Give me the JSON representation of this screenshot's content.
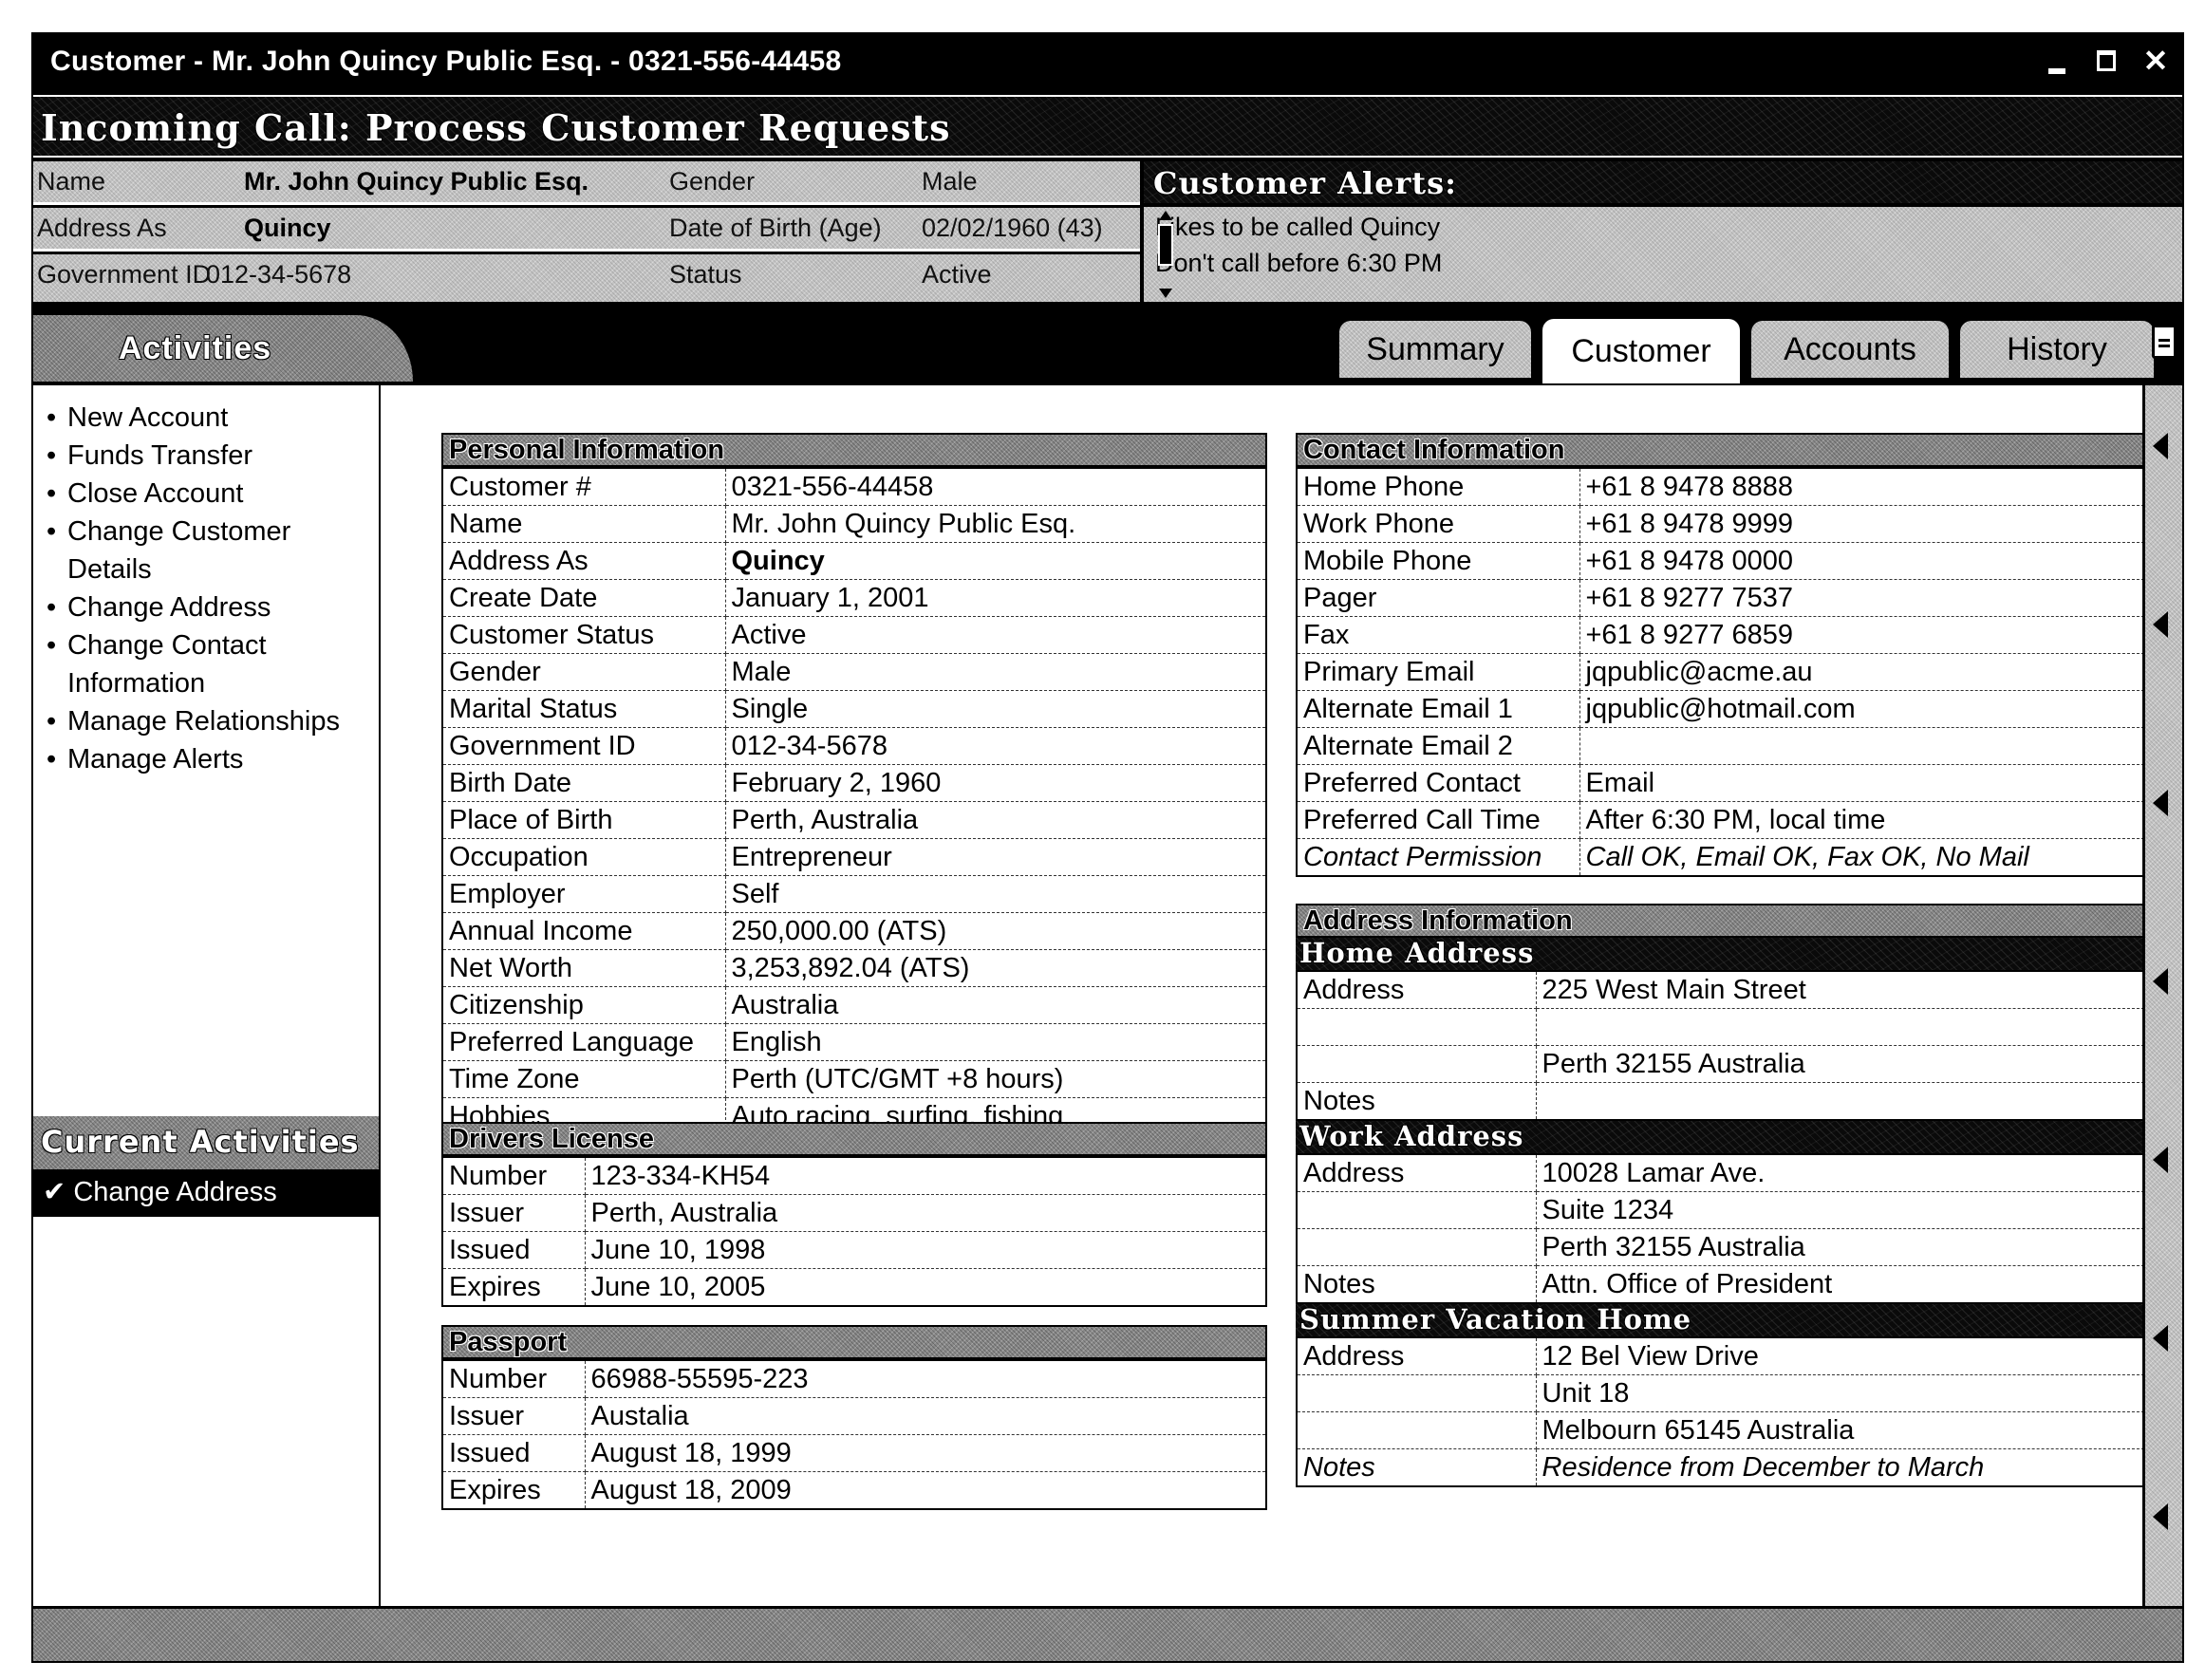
{
  "window": {
    "title": "Customer -   Mr. John Quincy Public Esq. - 0321-556-44458",
    "controls": {
      "minimize": "minimize-icon",
      "maximize": "maximize-icon",
      "close": "close-icon"
    }
  },
  "banner": {
    "title": "Incoming Call: Process Customer Requests"
  },
  "summary": {
    "rows": [
      {
        "label1": "Name",
        "value1": "Mr. John Quincy Public Esq.",
        "label2": "Gender",
        "value2": "Male"
      },
      {
        "label1": "Address As",
        "value1": "Quincy",
        "label2": "Date of Birth (Age)",
        "value2": "02/02/1960 (43)"
      },
      {
        "label1": "Government ID",
        "value1": "012-34-5678",
        "label2": "Status",
        "value2": "Active"
      }
    ]
  },
  "alerts": {
    "title": "Customer Alerts:",
    "items": [
      "Likes to be called Quincy",
      "Don't call before 6:30 PM"
    ]
  },
  "sidebar": {
    "title": "Activities",
    "items": [
      {
        "label": "New Account"
      },
      {
        "label": "Funds Transfer"
      },
      {
        "label": "Close Account"
      },
      {
        "label": "Change Customer Details"
      },
      {
        "label": "Change Address"
      },
      {
        "label": "Change Contact Information"
      },
      {
        "label": "Manage Relationships"
      },
      {
        "label": "Manage Alerts"
      }
    ],
    "current_title": "Current Activities >>",
    "current_items": [
      {
        "label": "✔ Change Address"
      }
    ]
  },
  "tabs": [
    {
      "label": "Summary",
      "active": false
    },
    {
      "label": "Customer",
      "active": true
    },
    {
      "label": "Accounts",
      "active": false
    },
    {
      "label": "History",
      "active": false
    }
  ],
  "personal": {
    "title": "Personal Information",
    "rows": [
      {
        "label": "Customer #",
        "value": "0321-556-44458"
      },
      {
        "label": "Name",
        "value": "Mr. John Quincy Public Esq."
      },
      {
        "label": "Address As",
        "value": "Quincy"
      },
      {
        "label": "Create Date",
        "value": "January 1, 2001"
      },
      {
        "label": "Customer Status",
        "value": "Active"
      },
      {
        "label": "Gender",
        "value": "Male"
      },
      {
        "label": "Marital Status",
        "value": "Single"
      },
      {
        "label": "Government ID",
        "value": "012-34-5678"
      },
      {
        "label": "Birth Date",
        "value": "February 2, 1960"
      },
      {
        "label": "Place of Birth",
        "value": "Perth, Australia"
      },
      {
        "label": "Occupation",
        "value": "Entrepreneur"
      },
      {
        "label": "Employer",
        "value": "Self"
      },
      {
        "label": "Annual Income",
        "value": "250,000.00 (ATS)"
      },
      {
        "label": "Net Worth",
        "value": "3,253,892.04 (ATS)"
      },
      {
        "label": "Citizenship",
        "value": "Australia"
      },
      {
        "label": "Preferred Language",
        "value": "English"
      },
      {
        "label": "Time Zone",
        "value": "Perth (UTC/GMT +8 hours)"
      },
      {
        "label": "Hobbies",
        "value": "Auto racing, surfing, fishing"
      }
    ]
  },
  "license": {
    "title": "Drivers License",
    "rows": [
      {
        "label": "Number",
        "value": "123-334-KH54"
      },
      {
        "label": "Issuer",
        "value": "Perth, Australia"
      },
      {
        "label": "Issued",
        "value": "June 10, 1998"
      },
      {
        "label": "Expires",
        "value": "June 10, 2005"
      }
    ]
  },
  "passport": {
    "title": "Passport",
    "rows": [
      {
        "label": "Number",
        "value": "66988-55595-223"
      },
      {
        "label": "Issuer",
        "value": "Austalia"
      },
      {
        "label": "Issued",
        "value": "August 18, 1999"
      },
      {
        "label": "Expires",
        "value": "August 18, 2009"
      }
    ]
  },
  "contact": {
    "title": "Contact Information",
    "rows": [
      {
        "label": "Home Phone",
        "value": "+61 8 9478 8888"
      },
      {
        "label": "Work Phone",
        "value": "+61 8 9478 9999"
      },
      {
        "label": "Mobile Phone",
        "value": "+61 8 9478 0000"
      },
      {
        "label": "Pager",
        "value": "+61 8 9277 7537"
      },
      {
        "label": "Fax",
        "value": "+61 8 9277 6859"
      },
      {
        "label": "Primary Email",
        "value": "jqpublic@acme.au"
      },
      {
        "label": "Alternate Email 1",
        "value": "jqpublic@hotmail.com"
      },
      {
        "label": "Alternate Email 2",
        "value": ""
      },
      {
        "label": "Preferred Contact",
        "value": "Email"
      },
      {
        "label": "Preferred Call Time",
        "value": "After 6:30 PM, local time"
      },
      {
        "label": "Contact Permission",
        "value": "Call OK, Email OK, Fax OK, No Mail"
      }
    ]
  },
  "address": {
    "title": "Address Information",
    "groups": [
      {
        "title": "Home Address",
        "rows": [
          {
            "label": "Address",
            "value": "225 West Main Street"
          },
          {
            "label": "",
            "value": ""
          },
          {
            "label": "",
            "value": "Perth 32155 Australia"
          },
          {
            "label": "Notes",
            "value": ""
          }
        ]
      },
      {
        "title": "Work Address",
        "rows": [
          {
            "label": "Address",
            "value": "10028 Lamar Ave."
          },
          {
            "label": "",
            "value": "Suite 1234"
          },
          {
            "label": "",
            "value": "Perth 32155 Australia"
          },
          {
            "label": "Notes",
            "value": "Attn. Office of President"
          }
        ]
      },
      {
        "title": "Summer Vacation Home",
        "rows": [
          {
            "label": "Address",
            "value": "12 Bel View Drive"
          },
          {
            "label": "",
            "value": "Unit 18"
          },
          {
            "label": "",
            "value": "Melbourn 65145 Australia"
          },
          {
            "label": "Notes",
            "value": "Residence from December to March"
          }
        ]
      }
    ]
  },
  "rightstrip": {
    "icon": "document-icon",
    "handles": 7
  }
}
